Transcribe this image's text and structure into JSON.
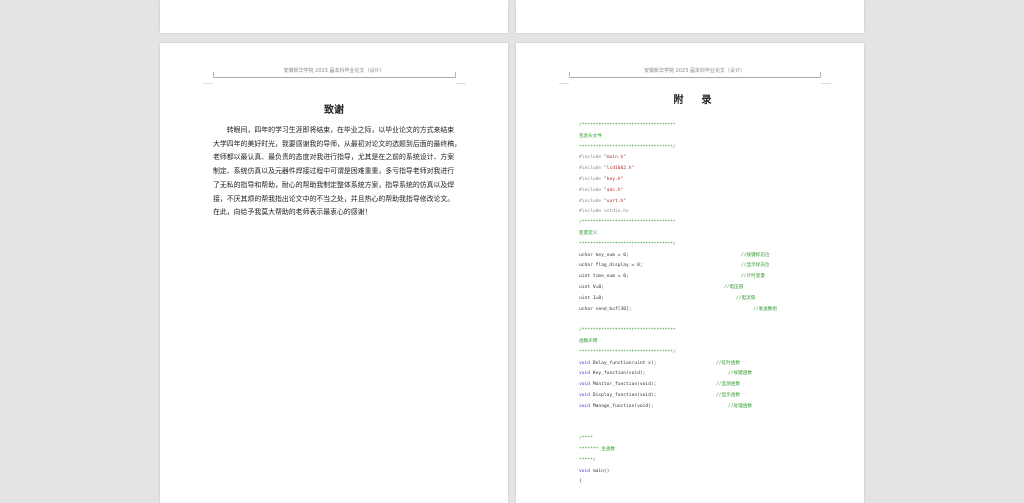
{
  "header_text": "安徽新华学院 2023 届本科毕业论文（设计）",
  "left_page": {
    "title": "致谢",
    "lines": [
      "　　转眼间，四年的学习生涯即将结束，在毕业之际，以毕业论文的方式来结束",
      "大学四年的美好时光，我要感谢我的导师，从最初对论文的选题到后面的最终稿，",
      "老师都以最认真、最负责的态度对我进行指导，尤其是在之前的系统设计、方案",
      "制定、系统仿真以及元器件焊接过程中可谓是困难重重，多亏指导老师对我进行",
      "了无私的指导和帮助，耐心的帮助我制定整体系统方案，指导系统的仿真以及焊",
      "接，不厌其烦的帮我指出论文中的不当之处，并且热心的帮助我指导修改论文。",
      "在此，向给予我莫大帮助的老师表示最衷心的感谢！"
    ]
  },
  "right_page": {
    "title": "附　录",
    "code": [
      {
        "t": "g",
        "s": "/**********************************"
      },
      {
        "t": "g",
        "s": "包含头文件"
      },
      {
        "t": "g",
        "s": "**********************************/"
      },
      {
        "t": "inc",
        "s": "#include ",
        "v": "\"main.h\""
      },
      {
        "t": "inc",
        "s": "#include ",
        "v": "\"lcd1602.h\""
      },
      {
        "t": "inc",
        "s": "#include ",
        "v": "\"key.h\""
      },
      {
        "t": "inc",
        "s": "#include ",
        "v": "\"adc.h\""
      },
      {
        "t": "inc",
        "s": "#include ",
        "v": "\"uart.h\""
      },
      {
        "t": "inc",
        "s": "#include <stdio.h>"
      },
      {
        "t": "g",
        "s": "/**********************************"
      },
      {
        "t": "g",
        "s": "变量定义"
      },
      {
        "t": "g",
        "s": "**********************************/"
      },
      {
        "t": "n",
        "s": "uchar key_num = 0;",
        "c": "//按键标志位"
      },
      {
        "t": "n",
        "s": "uchar flag_display = 0;",
        "c": "//显示标志位"
      },
      {
        "t": "n",
        "s": "uint time_num = 0;",
        "c": "//计时变量"
      },
      {
        "t": "n",
        "s": "uint V=0;",
        "c": "//电压值"
      },
      {
        "t": "n",
        "s": "uint I=0;",
        "c": "//电流值"
      },
      {
        "t": "n",
        "s": "uchar send_buf[30];",
        "c": "//发送数组"
      },
      {
        "t": "n",
        "s": ""
      },
      {
        "t": "g",
        "s": "/**********************************"
      },
      {
        "t": "g",
        "s": "函数声明"
      },
      {
        "t": "g",
        "s": "**********************************/"
      },
      {
        "t": "kw",
        "k": "void",
        "s": " Delay_function(uint x);",
        "c": "//延时函数"
      },
      {
        "t": "kw",
        "k": "void",
        "s": " Key_function(void);",
        "c": "//按键函数"
      },
      {
        "t": "kw",
        "k": "void",
        "s": " Monitor_function(void);",
        "c": "//监测函数"
      },
      {
        "t": "kw",
        "k": "void",
        "s": " Display_function(void);",
        "c": "//显示函数"
      },
      {
        "t": "kw",
        "k": "void",
        "s": " Manage_function(void);",
        "c": "//处理函数"
      },
      {
        "t": "n",
        "s": ""
      },
      {
        "t": "n",
        "s": ""
      },
      {
        "t": "g",
        "s": "/****"
      },
      {
        "t": "g",
        "s": "*******   主函数"
      },
      {
        "t": "g",
        "s": "*****/"
      },
      {
        "t": "kw",
        "k": "void",
        "s": " main()"
      },
      {
        "t": "n",
        "s": "{"
      }
    ]
  }
}
